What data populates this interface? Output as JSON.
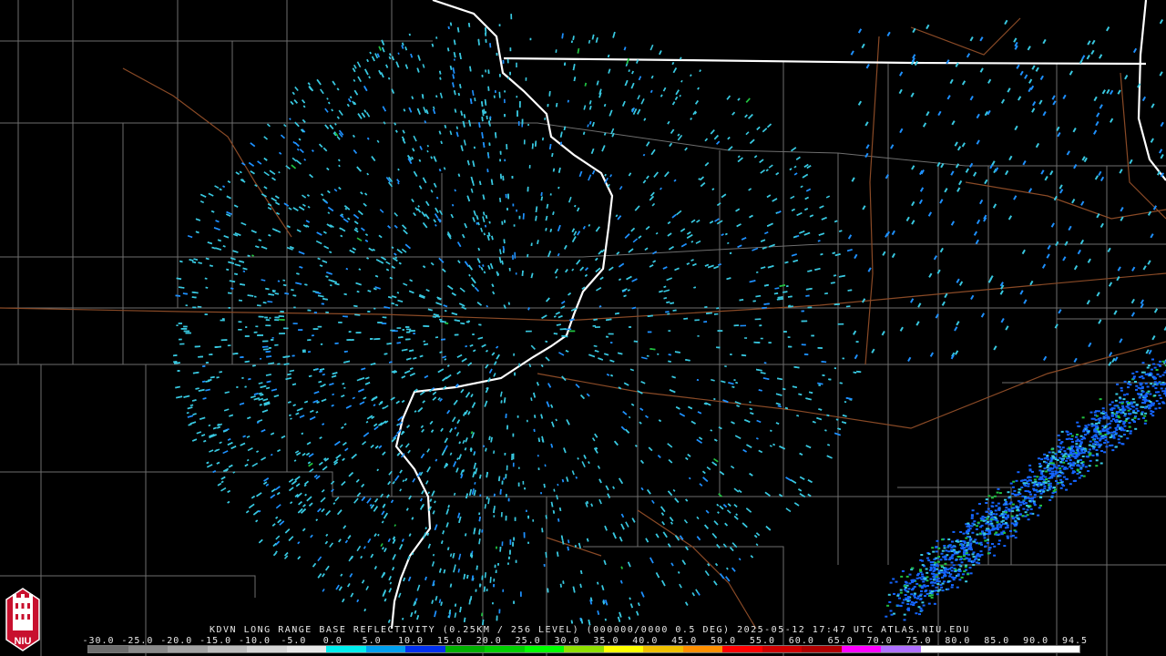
{
  "product": {
    "caption": "KDVN LONG RANGE BASE REFLECTIVITY (0.25KM / 256 LEVEL) (000000/0000 0.5 DEG) 2025-05-12 17:47 UTC  ATLAS.NIU.EDU"
  },
  "legend": {
    "values": [
      "-30.0",
      "-25.0",
      "-20.0",
      "-15.0",
      "-10.0",
      "-5.0",
      "0.0",
      "5.0",
      "10.0",
      "15.0",
      "20.0",
      "25.0",
      "30.0",
      "35.0",
      "40.0",
      "45.0",
      "50.0",
      "55.0",
      "60.0",
      "65.0",
      "70.0",
      "75.0",
      "80.0",
      "85.0",
      "90.0",
      "94.5"
    ],
    "colors": [
      "#6e6e6e",
      "#8a8a8a",
      "#a3a3a3",
      "#bdbdbd",
      "#d6d6d6",
      "#e8e8e8",
      "#00eeee",
      "#00a0f0",
      "#0030f0",
      "#00b000",
      "#00d000",
      "#00ff00",
      "#90e000",
      "#ffff00",
      "#f0c000",
      "#ff9000",
      "#ff0000",
      "#d00000",
      "#b00000",
      "#ff00ff",
      "#b070ff",
      "#ffffff",
      "#ffffff",
      "#ffffff",
      "#ffffff"
    ]
  },
  "logo": {
    "text": "NIU",
    "colors": {
      "red": "#c8102e",
      "white": "#ffffff"
    }
  },
  "map_colors": {
    "background": "#000000",
    "state_lines": "#ffffff",
    "county_lines": "#6e6e6e",
    "highways": "#8a4a26",
    "echo_light": "#38c8e0",
    "echo_medium": "#1e90ff",
    "echo_strong": "#1464ff",
    "echo_green": "#20c040"
  }
}
